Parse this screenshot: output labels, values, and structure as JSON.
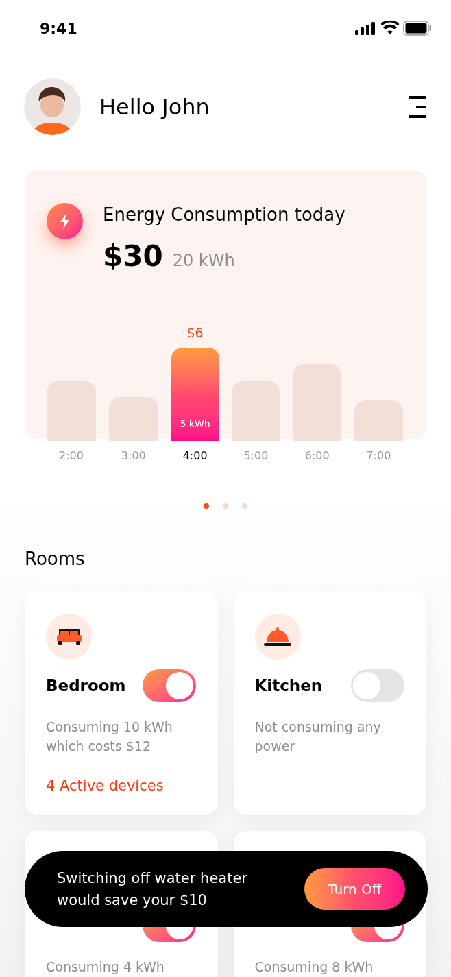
{
  "status_bar": {
    "time": "9:41"
  },
  "header": {
    "greeting": "Hello John"
  },
  "energy_card": {
    "title": "Energy Consumption today",
    "cost": "$30",
    "energy": "20 kWh",
    "bars": [
      {
        "label": "2:00",
        "selected": false
      },
      {
        "label": "3:00",
        "selected": false
      },
      {
        "label": "4:00",
        "selected": true,
        "cost": "$6",
        "energy": "5 kWh"
      },
      {
        "label": "5:00",
        "selected": false
      },
      {
        "label": "6:00",
        "selected": false
      },
      {
        "label": "7:00",
        "selected": false
      }
    ]
  },
  "pager": [
    {
      "selected": true
    },
    {
      "selected": false
    },
    {
      "selected": false
    }
  ],
  "rooms": {
    "title": "Rooms",
    "items": [
      {
        "name": "Bedroom",
        "kind": "bed",
        "on": true,
        "description": "Consuming 10 kWh which costs $12",
        "devices": "4 Active devices"
      },
      {
        "name": "Kitchen",
        "kind": "kitchen",
        "on": false,
        "description": "Not consuming any power"
      },
      {
        "kind": "none",
        "on": true,
        "description": "Consuming 4 kWh"
      },
      {
        "kind": "none",
        "on": true,
        "description": "Consuming 8 kWh"
      }
    ]
  },
  "toast": {
    "message": "Switching off water heater would save your $10",
    "button": "Turn Off"
  }
}
